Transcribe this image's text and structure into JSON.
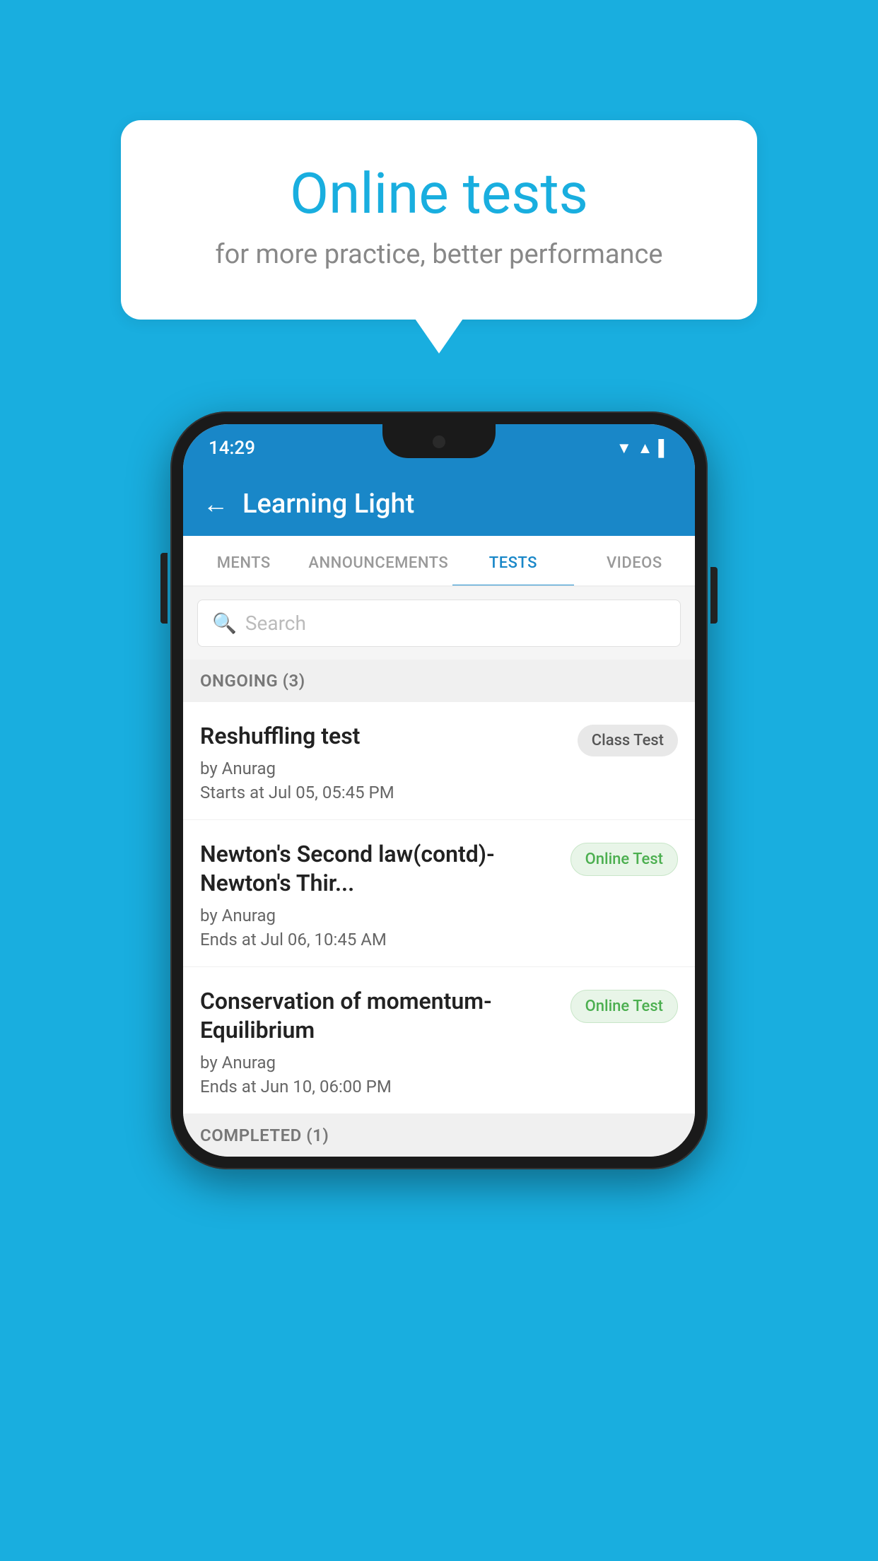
{
  "background": {
    "color": "#19AEDF"
  },
  "speech_bubble": {
    "title": "Online tests",
    "subtitle": "for more practice, better performance"
  },
  "phone": {
    "status_bar": {
      "time": "14:29",
      "icons": [
        "▼",
        "▲",
        "▌"
      ]
    },
    "app_header": {
      "back_label": "←",
      "title": "Learning Light"
    },
    "tabs": [
      {
        "label": "MENTS",
        "active": false
      },
      {
        "label": "ANNOUNCEMENTS",
        "active": false
      },
      {
        "label": "TESTS",
        "active": true
      },
      {
        "label": "VIDEOS",
        "active": false
      }
    ],
    "search": {
      "placeholder": "Search"
    },
    "sections": [
      {
        "header": "ONGOING (3)",
        "items": [
          {
            "title": "Reshuffling test",
            "by": "by Anurag",
            "date": "Starts at  Jul 05, 05:45 PM",
            "badge": "Class Test",
            "badge_type": "class"
          },
          {
            "title": "Newton's Second law(contd)-Newton's Thir...",
            "by": "by Anurag",
            "date": "Ends at  Jul 06, 10:45 AM",
            "badge": "Online Test",
            "badge_type": "online"
          },
          {
            "title": "Conservation of momentum-Equilibrium",
            "by": "by Anurag",
            "date": "Ends at  Jun 10, 06:00 PM",
            "badge": "Online Test",
            "badge_type": "online"
          }
        ]
      }
    ],
    "completed_header": "COMPLETED (1)"
  }
}
